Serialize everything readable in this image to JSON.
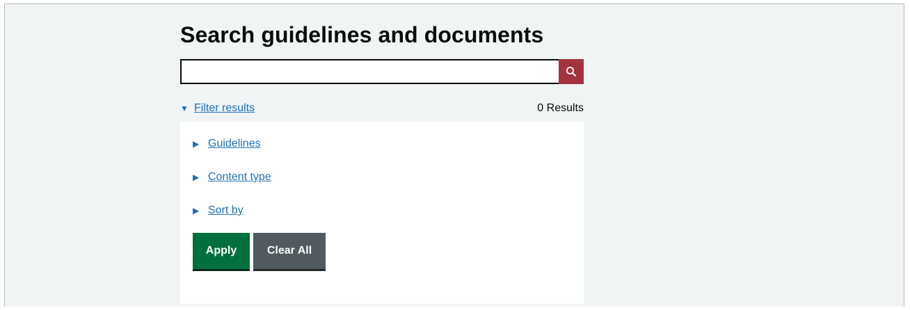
{
  "page": {
    "title": "Search guidelines and documents"
  },
  "search": {
    "value": "",
    "placeholder": "",
    "button_icon": "search-icon",
    "button_color": "#a4333f"
  },
  "filter": {
    "toggle_label": "Filter results",
    "toggle_state": "expanded",
    "results_count": "0 Results",
    "sections": [
      {
        "label": "Guidelines",
        "state": "collapsed"
      },
      {
        "label": "Content type",
        "state": "collapsed"
      },
      {
        "label": "Sort by",
        "state": "collapsed"
      }
    ]
  },
  "actions": {
    "apply_label": "Apply",
    "apply_color": "#00703c",
    "clear_label": "Clear All",
    "clear_color": "#505a5f"
  }
}
